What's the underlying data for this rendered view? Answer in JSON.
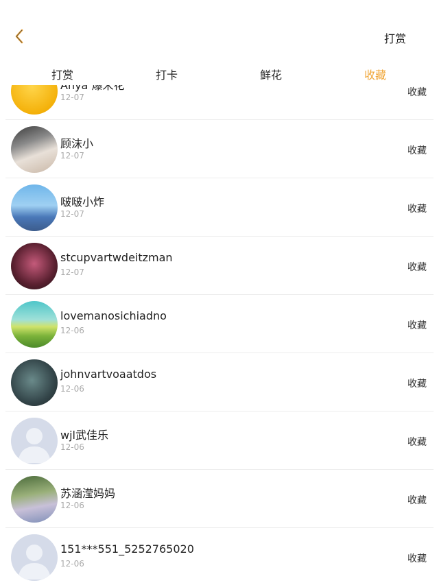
{
  "header": {
    "back_icon": "chevron-left-icon",
    "right_action": "打赏",
    "accent_color": "#f0a73a"
  },
  "tabs": [
    {
      "label": "打赏"
    },
    {
      "label": "打卡"
    },
    {
      "label": "鲜花"
    },
    {
      "label": "收藏",
      "active": true
    }
  ],
  "list": [
    {
      "name": "Anya 爆米花",
      "date": "12-07",
      "action": "收藏",
      "avatar": "yellow-photo"
    },
    {
      "name": "顾沫小",
      "date": "12-07",
      "action": "收藏",
      "avatar": "photo"
    },
    {
      "name": "啵啵小炸",
      "date": "12-07",
      "action": "收藏",
      "avatar": "photo"
    },
    {
      "name": "stcupvartwdeitzman",
      "date": "12-07",
      "action": "收藏",
      "avatar": "photo"
    },
    {
      "name": "lovemanosichiadno",
      "date": "12-06",
      "action": "收藏",
      "avatar": "photo"
    },
    {
      "name": "johnvartvoaatdos",
      "date": "12-06",
      "action": "收藏",
      "avatar": "photo"
    },
    {
      "name": "wjl武佳乐",
      "date": "12-06",
      "action": "收藏",
      "avatar": "default-avatar"
    },
    {
      "name": "苏涵滢妈妈",
      "date": "12-06",
      "action": "收藏",
      "avatar": "photo"
    },
    {
      "name": "151***551_5252765020",
      "date": "12-06",
      "action": "收藏",
      "avatar": "default-avatar"
    }
  ]
}
